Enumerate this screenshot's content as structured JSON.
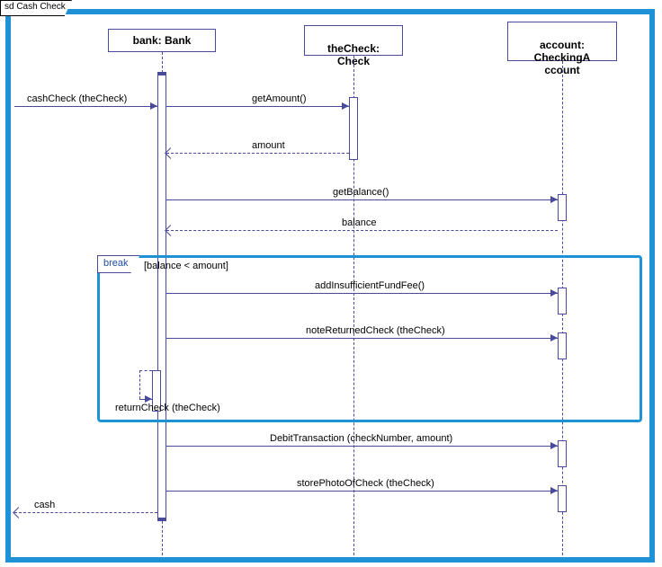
{
  "diagram": {
    "title": "sd Cash Check",
    "lifelines": {
      "bank": {
        "name": "bank: Bank"
      },
      "check": {
        "name": "theCheck:\nCheck"
      },
      "account": {
        "name": "account:\nCheckingA\nccount"
      }
    },
    "fragment": {
      "operator": "break",
      "guard": "[balance < amount]"
    },
    "messages": {
      "m1": "cashCheck (theCheck)",
      "m2": "getAmount()",
      "m3": "amount",
      "m4": "getBalance()",
      "m5": "balance",
      "m6": "addInsufficientFundFee()",
      "m7": "noteReturnedCheck (theCheck)",
      "m8": "returnCheck (theCheck)",
      "m9": "DebitTransaction (checkNumber, amount)",
      "m10": "storePhotoOfCheck (theCheck)",
      "m11": "cash"
    }
  }
}
